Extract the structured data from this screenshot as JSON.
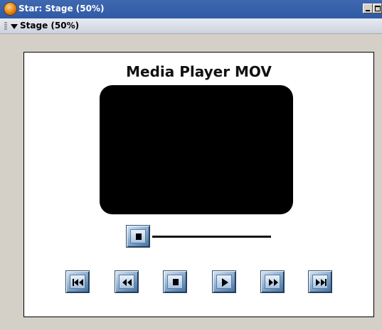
{
  "window": {
    "title": "Star: Stage (50%)"
  },
  "panel": {
    "title": "Stage (50%)"
  },
  "stage": {
    "title": "Media Player MOV"
  },
  "icons": {
    "app": "director-app-icon",
    "collapse": "triangle-down-icon",
    "stop": "stop-icon",
    "go_to_start": "skip-to-start-icon",
    "rewind": "rewind-icon",
    "play": "play-icon",
    "fast_forward": "fast-forward-icon",
    "go_to_end": "skip-to-end-icon"
  },
  "colors": {
    "titlebar": "#2f5aa6",
    "stage_bg": "#ffffff",
    "video_bg": "#000000",
    "button_face": "#8fb0d3"
  }
}
